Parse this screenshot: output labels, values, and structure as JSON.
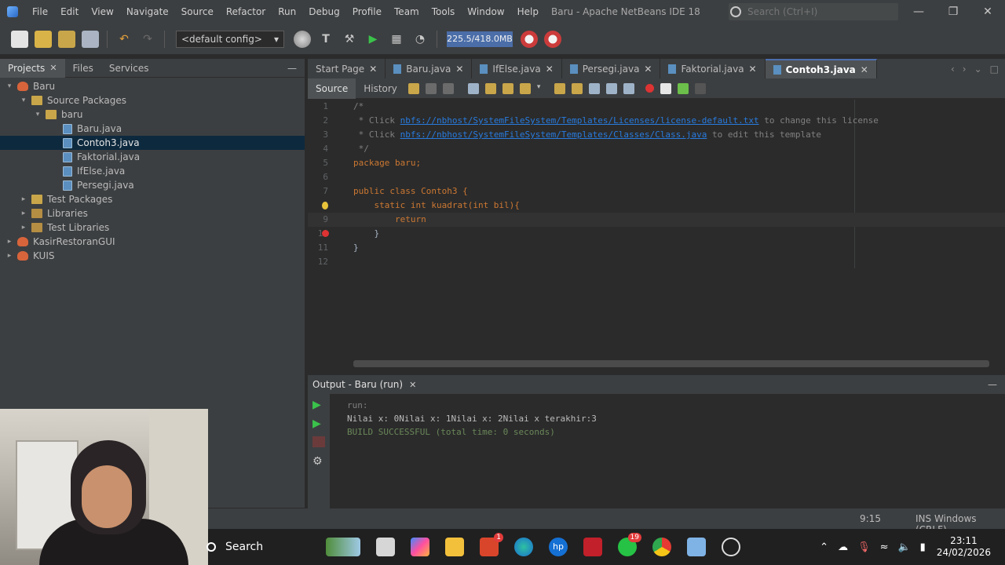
{
  "window": {
    "title": "Baru - Apache NetBeans IDE 18",
    "search_placeholder": "Search (Ctrl+I)"
  },
  "menu": [
    "File",
    "Edit",
    "View",
    "Navigate",
    "Source",
    "Refactor",
    "Run",
    "Debug",
    "Profile",
    "Team",
    "Tools",
    "Window",
    "Help"
  ],
  "toolbar": {
    "config": "<default config>",
    "memory": "225.5/418.0MB"
  },
  "panel_tabs": [
    {
      "label": "Projects",
      "active": true
    },
    {
      "label": "Files"
    },
    {
      "label": "Services"
    }
  ],
  "tree": [
    {
      "label": "Baru",
      "depth": 0,
      "icon": "project",
      "open": true
    },
    {
      "label": "Source Packages",
      "depth": 1,
      "icon": "package",
      "open": true
    },
    {
      "label": "baru",
      "depth": 2,
      "icon": "package",
      "open": true
    },
    {
      "label": "Baru.java",
      "depth": 3,
      "icon": "java"
    },
    {
      "label": "Contoh3.java",
      "depth": 3,
      "icon": "java",
      "selected": true
    },
    {
      "label": "Faktorial.java",
      "depth": 3,
      "icon": "java"
    },
    {
      "label": "IfElse.java",
      "depth": 3,
      "icon": "java"
    },
    {
      "label": "Persegi.java",
      "depth": 3,
      "icon": "java"
    },
    {
      "label": "Test Packages",
      "depth": 1,
      "icon": "package",
      "open": false
    },
    {
      "label": "Libraries",
      "depth": 1,
      "icon": "library",
      "open": false
    },
    {
      "label": "Test Libraries",
      "depth": 1,
      "icon": "library",
      "open": false
    },
    {
      "label": "KasirRestoranGUI",
      "depth": 0,
      "icon": "project",
      "open": false
    },
    {
      "label": "KUIS",
      "depth": 0,
      "icon": "project",
      "open": false
    }
  ],
  "editor_tabs": [
    "Start Page",
    "Baru.java",
    "IfElse.java",
    "Persegi.java",
    "Faktorial.java",
    "Contoh3.java"
  ],
  "editor_subtabs": [
    "Source",
    "History"
  ],
  "code_lines": [
    {
      "n": "1",
      "text": "/*"
    },
    {
      "n": "2",
      "pre": " * Click ",
      "link": "nbfs://nbhost/SystemFileSystem/Templates/Licenses/license-default.txt",
      "post": " to change this license"
    },
    {
      "n": "3",
      "pre": " * Click ",
      "link": "nbfs://nbhost/SystemFileSystem/Templates/Classes/Class.java",
      "post": " to edit this template"
    },
    {
      "n": "4",
      "text": " */"
    },
    {
      "n": "5",
      "text": "package baru;"
    },
    {
      "n": "6",
      "text": ""
    },
    {
      "n": "7",
      "text": "public class Contoh3 {"
    },
    {
      "n": "8",
      "text": "    static int kuadrat(int bil){"
    },
    {
      "n": "9",
      "text": "        return"
    },
    {
      "n": "10",
      "text": "    }"
    },
    {
      "n": "11",
      "text": "}"
    },
    {
      "n": "12",
      "text": ""
    }
  ],
  "output": {
    "tab": "Output - Baru (run)",
    "lines": [
      "run:",
      "Nilai x: 0Nilai x: 1Nilai x: 2Nilai x terakhir:3",
      "BUILD SUCCESSFUL (total time: 0 seconds)"
    ]
  },
  "status": {
    "position": "9:15",
    "mode": "INS Windows (CRLF)"
  },
  "taskbar": {
    "search": "Search",
    "time": "23:11",
    "date": "24/02/2026",
    "badge_office": "1",
    "badge_whatsapp": "19"
  }
}
